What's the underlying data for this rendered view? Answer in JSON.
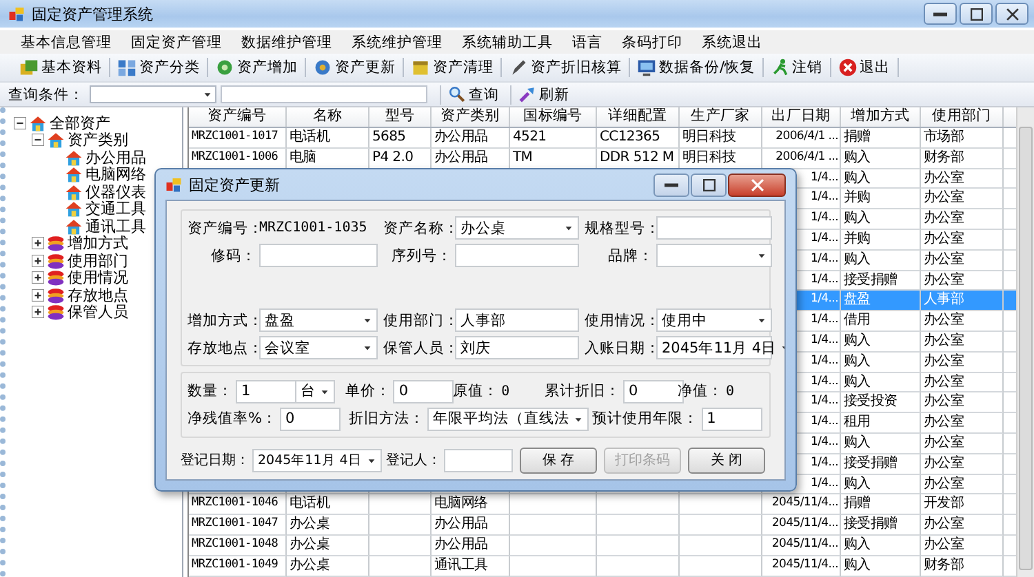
{
  "window": {
    "title": "固定资产管理系统"
  },
  "menu": [
    "基本信息管理",
    "固定资产管理",
    "数据维护管理",
    "系统维护管理",
    "系统辅助工具",
    "语言",
    "条码打印",
    "系统退出"
  ],
  "toolbar": [
    {
      "label": "基本资料"
    },
    {
      "label": "资产分类"
    },
    {
      "label": "资产增加"
    },
    {
      "label": "资产更新"
    },
    {
      "label": "资产清理"
    },
    {
      "label": "资产折旧核算"
    },
    {
      "label": "数据备份/恢复"
    },
    {
      "label": "注销"
    },
    {
      "label": "退出"
    }
  ],
  "query": {
    "label": "查询条件：",
    "buttons": [
      {
        "label": "查询"
      },
      {
        "label": "刷新"
      }
    ]
  },
  "tree": [
    {
      "label": "全部资产",
      "expanded": true,
      "children": [
        {
          "label": "资产类别",
          "expanded": true,
          "children": [
            {
              "label": "办公用品"
            },
            {
              "label": "电脑网络"
            },
            {
              "label": "仪器仪表"
            },
            {
              "label": "交通工具"
            },
            {
              "label": "通讯工具"
            }
          ]
        },
        {
          "label": "增加方式",
          "expanded": false
        },
        {
          "label": "使用部门",
          "expanded": false
        },
        {
          "label": "使用情况",
          "expanded": false
        },
        {
          "label": "存放地点",
          "expanded": false
        },
        {
          "label": "保管人员",
          "expanded": false
        }
      ]
    }
  ],
  "grid": {
    "columns": [
      "资产编号",
      "名称",
      "型号",
      "资产类别",
      "国标编号",
      "详细配置",
      "生产厂家",
      "出厂日期",
      "增加方式",
      "使用部门"
    ],
    "rows": [
      {
        "selected": false,
        "cells": [
          "MRZC1001-1017",
          "电话机",
          "5685",
          "办公用品",
          "4521",
          "CC12365",
          "明日科技",
          "2006/4/1 ...",
          "捐赠",
          "市场部"
        ]
      },
      {
        "selected": false,
        "cells": [
          "MRZC1001-1006",
          "电脑",
          "P4 2.0",
          "办公用品",
          "TM",
          "DDR 512 M",
          "明日科技",
          "2006/4/1 ...",
          "购入",
          "财务部"
        ]
      },
      {
        "selected": false,
        "cells": [
          null,
          null,
          null,
          null,
          null,
          null,
          null,
          "1/4...",
          "购入",
          "办公室"
        ]
      },
      {
        "selected": false,
        "cells": [
          null,
          null,
          null,
          null,
          null,
          null,
          null,
          "1/4...",
          "并购",
          "办公室"
        ]
      },
      {
        "selected": false,
        "cells": [
          null,
          null,
          null,
          null,
          null,
          null,
          null,
          "1/4...",
          "购入",
          "办公室"
        ]
      },
      {
        "selected": false,
        "cells": [
          null,
          null,
          null,
          null,
          null,
          null,
          null,
          "1/4...",
          "并购",
          "办公室"
        ]
      },
      {
        "selected": false,
        "cells": [
          null,
          null,
          null,
          null,
          null,
          null,
          null,
          "1/4...",
          "购入",
          "办公室"
        ]
      },
      {
        "selected": false,
        "cells": [
          null,
          null,
          null,
          null,
          null,
          null,
          null,
          "1/4...",
          "接受捐赠",
          "办公室"
        ]
      },
      {
        "selected": true,
        "cells": [
          null,
          null,
          null,
          null,
          null,
          null,
          null,
          "1/4...",
          "盘盈",
          "人事部"
        ]
      },
      {
        "selected": false,
        "cells": [
          null,
          null,
          null,
          null,
          null,
          null,
          null,
          "1/4...",
          "借用",
          "办公室"
        ]
      },
      {
        "selected": false,
        "cells": [
          null,
          null,
          null,
          null,
          null,
          null,
          null,
          "1/4...",
          "购入",
          "办公室"
        ]
      },
      {
        "selected": false,
        "cells": [
          null,
          null,
          null,
          null,
          null,
          null,
          null,
          "1/4...",
          "购入",
          "办公室"
        ]
      },
      {
        "selected": false,
        "cells": [
          null,
          null,
          null,
          null,
          null,
          null,
          null,
          "1/4...",
          "购入",
          "办公室"
        ]
      },
      {
        "selected": false,
        "cells": [
          null,
          null,
          null,
          null,
          null,
          null,
          null,
          "1/4...",
          "接受投资",
          "办公室"
        ]
      },
      {
        "selected": false,
        "cells": [
          null,
          null,
          null,
          null,
          null,
          null,
          null,
          "1/4...",
          "租用",
          "办公室"
        ]
      },
      {
        "selected": false,
        "cells": [
          null,
          null,
          null,
          null,
          null,
          null,
          null,
          "1/4...",
          "购入",
          "办公室"
        ]
      },
      {
        "selected": false,
        "cells": [
          null,
          null,
          null,
          null,
          null,
          null,
          null,
          "1/4...",
          "接受捐赠",
          "办公室"
        ]
      },
      {
        "selected": false,
        "cells": [
          null,
          null,
          null,
          null,
          null,
          null,
          null,
          "1/4...",
          "购入",
          "办公室"
        ]
      },
      {
        "selected": false,
        "cells": [
          "MRZC1001-1046",
          "电话机",
          null,
          "电脑网络",
          null,
          null,
          null,
          "2045/11/4...",
          "捐赠",
          "开发部"
        ]
      },
      {
        "selected": false,
        "cells": [
          "MRZC1001-1047",
          "办公桌",
          null,
          "办公用品",
          null,
          null,
          null,
          "2045/11/4...",
          "接受捐赠",
          "办公室"
        ]
      },
      {
        "selected": false,
        "cells": [
          "MRZC1001-1048",
          "办公桌",
          null,
          "办公用品",
          null,
          null,
          null,
          "2045/11/4...",
          "购入",
          "办公室"
        ]
      },
      {
        "selected": false,
        "cells": [
          "MRZC1001-1049",
          "办公桌",
          null,
          "通讯工具",
          null,
          null,
          null,
          "2045/11/4...",
          "购入",
          "财务部"
        ]
      }
    ]
  },
  "dialog": {
    "title": "固定资产更新",
    "form": [
      [
        {
          "kind": "readout",
          "label": "资产编号：",
          "value": "MRZC1001-1035"
        },
        {
          "kind": "combo",
          "label": "资产名称：",
          "value": "办公桌"
        },
        {
          "kind": "input",
          "label": "规格型号："
        }
      ],
      [
        {
          "kind": "input",
          "label": "修码："
        },
        {
          "kind": "input",
          "label": "序列号："
        },
        {
          "kind": "combo",
          "label": "品牌："
        }
      ],
      [
        {
          "kind": "combo",
          "label": "增加方式：",
          "value": "盘盈"
        },
        {
          "kind": "input",
          "label": "使用部门：",
          "value": "人事部"
        },
        {
          "kind": "combo",
          "label": "使用情况：",
          "value": "使用中"
        }
      ],
      [
        {
          "kind": "combo",
          "label": "存放地点：",
          "value": "会议室"
        },
        {
          "kind": "input",
          "label": "保管人员：",
          "value": "刘庆"
        },
        {
          "kind": "combo",
          "label": "入账日期：",
          "value": "2045年11月 4日"
        }
      ]
    ],
    "costs": [
      [
        {
          "kind": "input",
          "label": "数量：",
          "value": "1"
        },
        {
          "kind": "combo",
          "value": "台"
        },
        {
          "kind": "input",
          "label": "单价：",
          "value": "0"
        },
        {
          "kind": "readout",
          "label": "原值：",
          "value": "0"
        },
        {
          "kind": "input",
          "label": "累计折旧：",
          "value": "0"
        },
        {
          "kind": "readout",
          "label": "净值：",
          "value": "0"
        }
      ],
      [
        {
          "kind": "input",
          "label": "净残值率%：",
          "value": "0"
        },
        {
          "kind": "combo",
          "label": "折旧方法：",
          "value": "年限平均法（直线法"
        },
        {
          "kind": "input",
          "label": "预计使用年限：",
          "value": "1"
        }
      ]
    ],
    "footer": [
      {
        "kind": "combo",
        "label": "登记日期：",
        "value": "2045年11月 4日"
      },
      {
        "kind": "input",
        "label": "登记人："
      },
      {
        "kind": "button",
        "label": "保 存",
        "disabled": false
      },
      {
        "kind": "button",
        "label": "打印条码",
        "disabled": true
      },
      {
        "kind": "button",
        "label": "关 闭",
        "disabled": false
      }
    ]
  }
}
